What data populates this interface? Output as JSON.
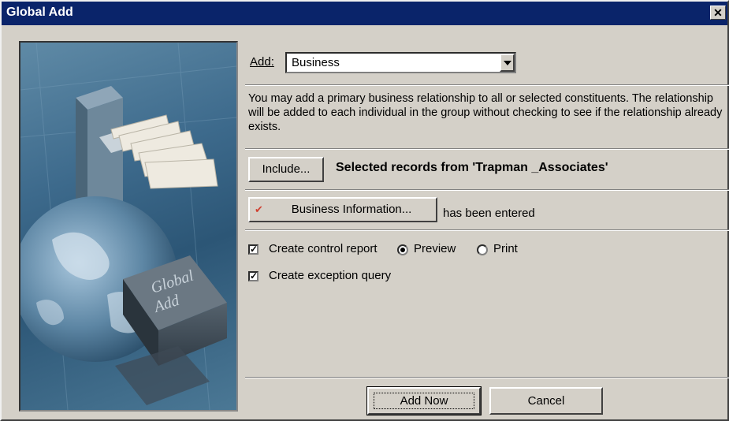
{
  "window": {
    "title": "Global Add",
    "close_glyph": "✕"
  },
  "image_panel": {
    "caption_line1": "Global",
    "caption_line2": "Add"
  },
  "add": {
    "label": "Add:",
    "selected": "Business"
  },
  "description": "You may add a primary business relationship to all or selected constituents.  The relationship will be added to each individual in the group without checking to see if the relationship already exists.",
  "include": {
    "button_label": "Include...",
    "status": "Selected records from 'Trapman _Associates'"
  },
  "business_info": {
    "check_glyph": "✔",
    "check_color": "#d04030",
    "button_label": "Business Information...",
    "status": "has been entered"
  },
  "options": {
    "control_report_label": "Create control report",
    "control_report_checked": true,
    "preview_label": "Preview",
    "print_label": "Print",
    "selected_output": "Preview",
    "exception_query_label": "Create exception query",
    "exception_query_checked": true
  },
  "footer": {
    "add_now_label": "Add Now",
    "cancel_label": "Cancel"
  },
  "colors": {
    "titlebar": "#0a246a",
    "dialog_face": "#d4d0c8"
  }
}
